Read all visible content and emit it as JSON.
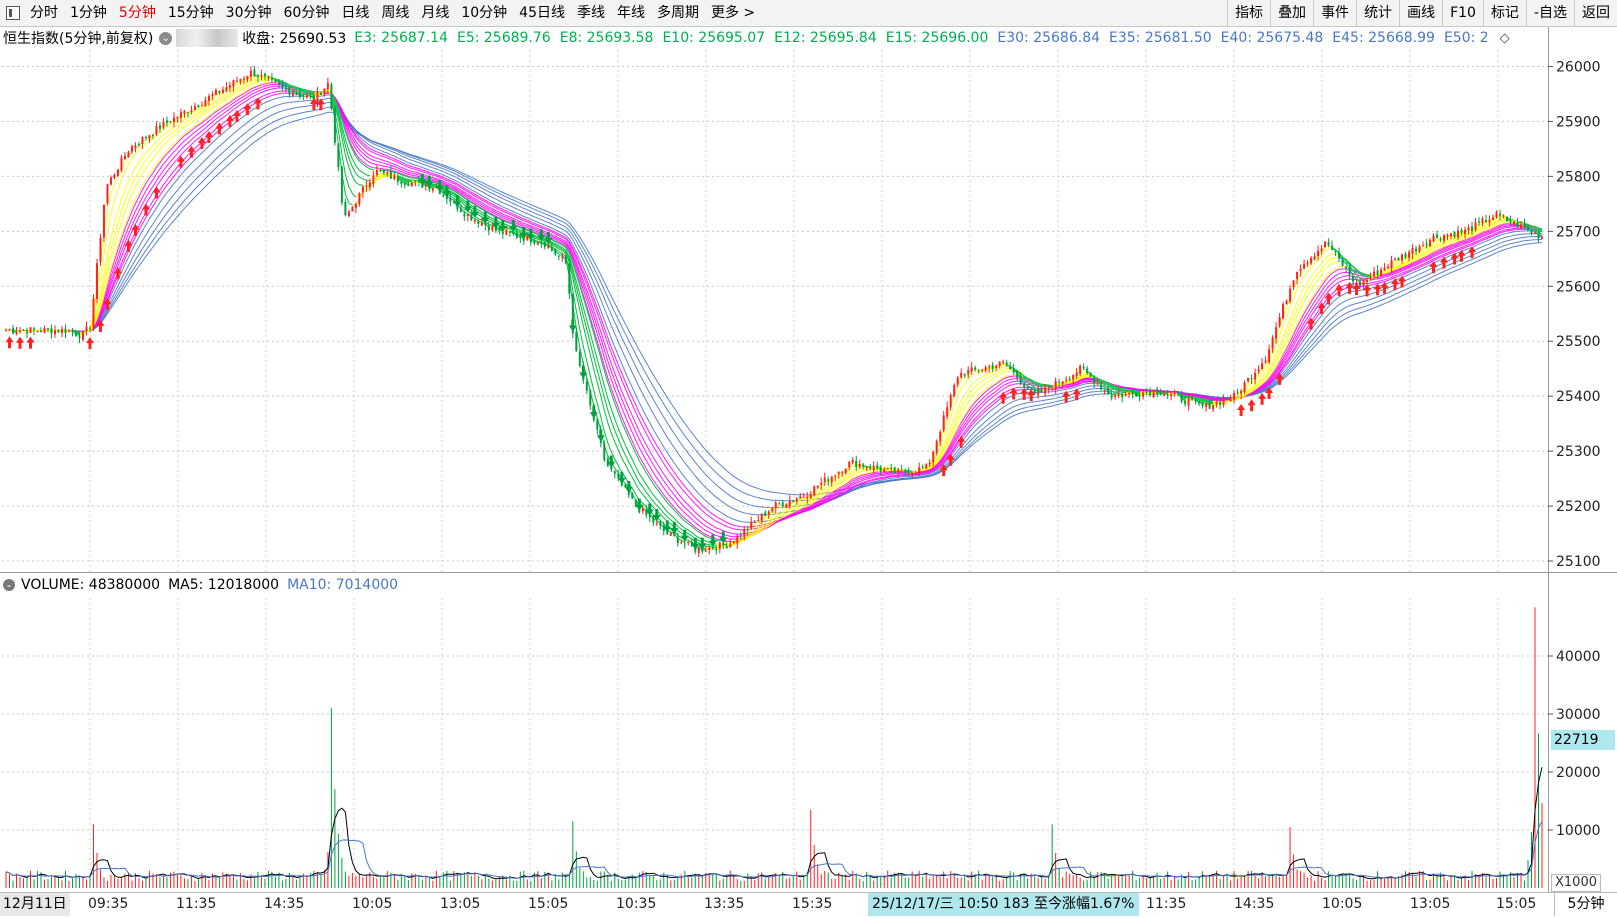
{
  "toolbar": {
    "periods": [
      "分时",
      "1分钟",
      "5分钟",
      "15分钟",
      "30分钟",
      "60分钟",
      "日线",
      "周线",
      "月线",
      "10分钟",
      "45日线",
      "季线",
      "年线",
      "多周期",
      "更多 >"
    ],
    "active_period": "5分钟",
    "tools": [
      "指标",
      "叠加",
      "事件",
      "统计",
      "画线",
      "F10",
      "标记",
      "-自选",
      "返回"
    ]
  },
  "infobar": {
    "title": "恒生指数(5分钟,前复权)",
    "close_label": "收盘: 25690.53",
    "ema_green": [
      "E3: 25687.14",
      "E5: 25689.76",
      "E8: 25693.58",
      "E10: 25695.07",
      "E12: 25695.84",
      "E15: 25696.00"
    ],
    "ema_blue": [
      "E30: 25686.84",
      "E35: 25681.50",
      "E40: 25675.48",
      "E45: 25668.99",
      "E50: 2"
    ]
  },
  "price_axis": {
    "labels": [
      "26000",
      "25900",
      "25800",
      "25700",
      "25600",
      "25500",
      "25400",
      "25300",
      "25200",
      "25100"
    ],
    "values": [
      26000,
      25900,
      25800,
      25700,
      25600,
      25500,
      25400,
      25300,
      25200,
      25100
    ]
  },
  "volume": {
    "label": "VOLUME: 48380000",
    "ma5_label": "MA5: 12018000",
    "ma10_label": "MA10: 7014000",
    "axis_labels": [
      "40000",
      "30000",
      "20000",
      "10000"
    ],
    "axis_values": [
      40000,
      30000,
      20000,
      10000
    ],
    "current_tag": "22719",
    "unit_label": "X1000"
  },
  "time_axis": {
    "date_label": "12月11日",
    "ticks": [
      "09:35",
      "11:35",
      "14:35",
      "10:05",
      "13:05",
      "15:05",
      "10:35",
      "13:35",
      "15:35",
      "10:05",
      "11:35",
      "14:35",
      "10:05",
      "13:05",
      "15:05"
    ],
    "status": "25/12/17/三 10:50 183 至今涨幅1.67%",
    "period_button": "5分钟"
  },
  "colors": {
    "up": "#ff2020",
    "down": "#00a040",
    "ema_short": "#ffff00",
    "ema_mid": "#ff00ff",
    "ema_long": "#4a78c8",
    "ema_green": "#00c060"
  },
  "chart_data": {
    "type": "candlestick",
    "ylim": [
      25080,
      26030
    ],
    "close_path": [
      [
        0,
        25520
      ],
      [
        0.04,
        25520
      ],
      [
        0.05,
        25510
      ],
      [
        0.055,
        25530
      ],
      [
        0.065,
        25780
      ],
      [
        0.08,
        25850
      ],
      [
        0.1,
        25890
      ],
      [
        0.13,
        25940
      ],
      [
        0.16,
        25990
      ],
      [
        0.18,
        25960
      ],
      [
        0.2,
        25940
      ],
      [
        0.21,
        25970
      ],
      [
        0.22,
        25720
      ],
      [
        0.24,
        25810
      ],
      [
        0.26,
        25790
      ],
      [
        0.28,
        25780
      ],
      [
        0.3,
        25730
      ],
      [
        0.32,
        25700
      ],
      [
        0.35,
        25680
      ],
      [
        0.365,
        25640
      ],
      [
        0.37,
        25490
      ],
      [
        0.39,
        25280
      ],
      [
        0.41,
        25200
      ],
      [
        0.43,
        25150
      ],
      [
        0.45,
        25120
      ],
      [
        0.47,
        25130
      ],
      [
        0.5,
        25200
      ],
      [
        0.52,
        25220
      ],
      [
        0.55,
        25280
      ],
      [
        0.58,
        25260
      ],
      [
        0.6,
        25270
      ],
      [
        0.62,
        25440
      ],
      [
        0.65,
        25460
      ],
      [
        0.67,
        25400
      ],
      [
        0.7,
        25450
      ],
      [
        0.72,
        25400
      ],
      [
        0.75,
        25410
      ],
      [
        0.78,
        25380
      ],
      [
        0.8,
        25400
      ],
      [
        0.82,
        25470
      ],
      [
        0.84,
        25630
      ],
      [
        0.86,
        25680
      ],
      [
        0.88,
        25600
      ],
      [
        0.9,
        25640
      ],
      [
        0.93,
        25690
      ],
      [
        0.95,
        25700
      ],
      [
        0.97,
        25730
      ],
      [
        1,
        25690
      ]
    ],
    "volume_spikes": [
      {
        "pos": 0.057,
        "value": 11000
      },
      {
        "pos": 0.212,
        "value": 31000
      },
      {
        "pos": 0.37,
        "value": 11500
      },
      {
        "pos": 0.525,
        "value": 13500
      },
      {
        "pos": 0.68,
        "value": 11000
      },
      {
        "pos": 0.836,
        "value": 10500
      },
      {
        "pos": 0.995,
        "value": 48380
      }
    ]
  }
}
